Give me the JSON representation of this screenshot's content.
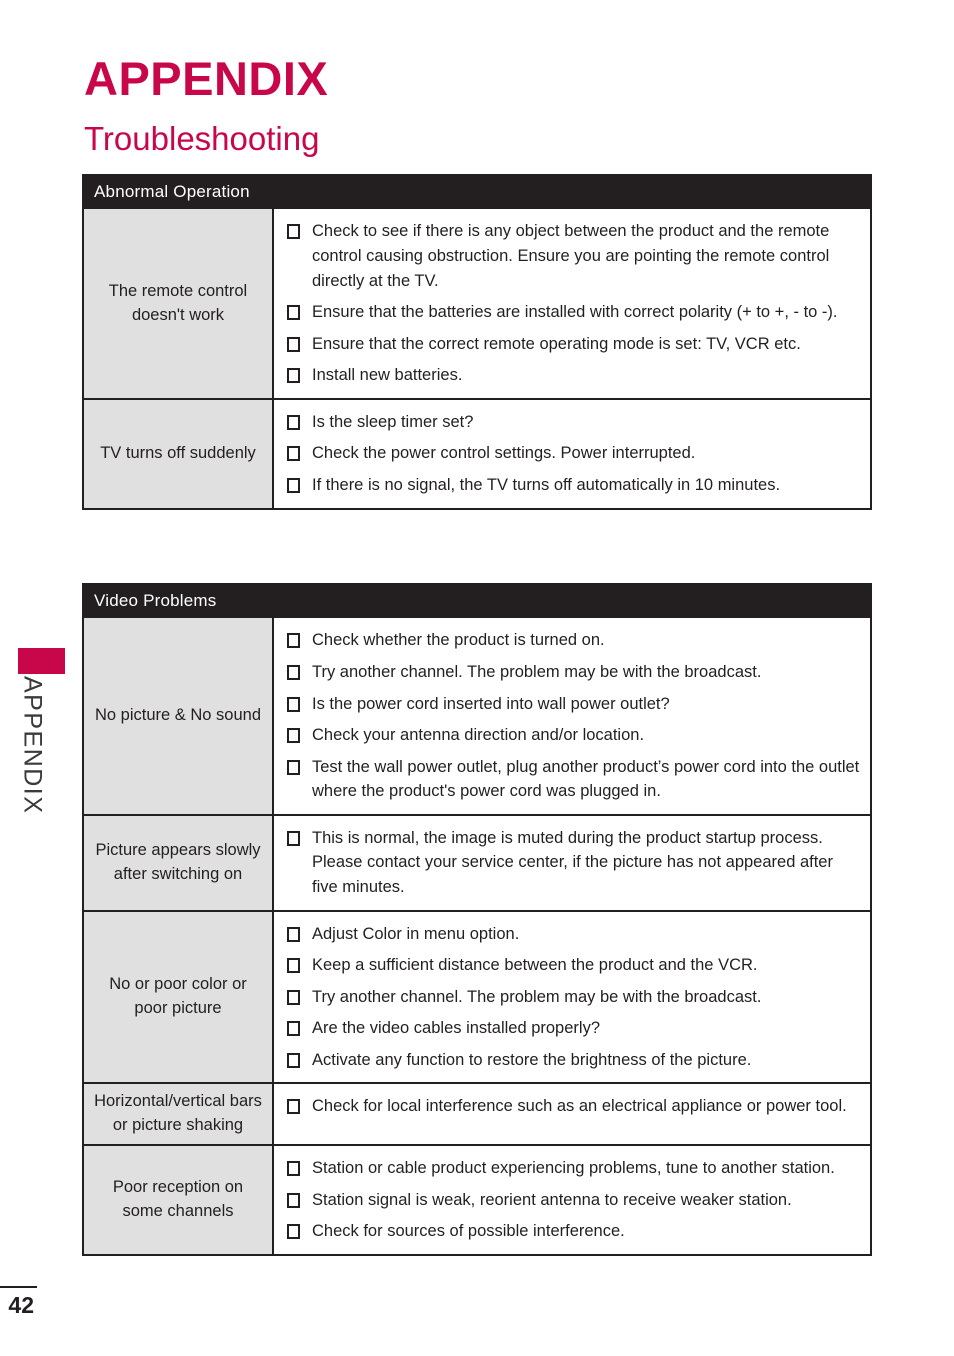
{
  "page": {
    "title": "APPENDIX",
    "subtitle": "Troubleshooting",
    "number": "42",
    "side_tab_label": "APPENDIX",
    "accent_color": "#c8074b",
    "header_bg_color": "#231f20",
    "label_cell_color": "#e0e0e0"
  },
  "tables": [
    {
      "header": "Abnormal Operation",
      "rows": [
        {
          "label": "The remote control doesn't work",
          "items": [
            "Check to see if there is any object between the product and the remote control causing obstruction. Ensure you are pointing the remote control directly at the TV.",
            "Ensure that the batteries are installed with correct polarity (+ to +, - to -).",
            "Ensure that the correct remote operating mode is set: TV, VCR etc.",
            "Install new batteries."
          ]
        },
        {
          "label": "TV turns off suddenly",
          "items": [
            "Is the sleep timer set?",
            "Check the power control settings. Power interrupted.",
            "If there is no signal, the TV turns off automatically in 10 minutes."
          ]
        }
      ]
    },
    {
      "header": "Video Problems",
      "rows": [
        {
          "label": "No picture & No sound",
          "items": [
            "Check whether the product is turned on.",
            "Try another channel. The problem may be with the broadcast.",
            "Is the power cord inserted into wall power outlet?",
            "Check your antenna direction and/or location.",
            "Test the wall power outlet, plug another product’s power cord into the outlet where the product's power cord was plugged in."
          ]
        },
        {
          "label": "Picture appears slowly after switching on",
          "items": [
            "This is normal, the image is muted during the product startup process. Please contact your service center, if the picture has not appeared after five minutes."
          ]
        },
        {
          "label": "No or poor color or poor picture",
          "items": [
            "Adjust Color in menu option.",
            "Keep a sufficient distance between the product and the VCR.",
            "Try another channel. The problem may be with the broadcast.",
            "Are the video cables installed properly?",
            "Activate any function to restore the brightness of the picture."
          ]
        },
        {
          "label": "Horizontal/vertical bars or picture shaking",
          "items": [
            "Check for local interference such as an electrical appliance or power tool."
          ]
        },
        {
          "label": "Poor reception on some channels",
          "items": [
            "Station or cable product experiencing problems, tune to another station.",
            "Station signal is weak, reorient antenna to receive weaker station.",
            "Check for sources of possible interference."
          ]
        }
      ]
    }
  ]
}
